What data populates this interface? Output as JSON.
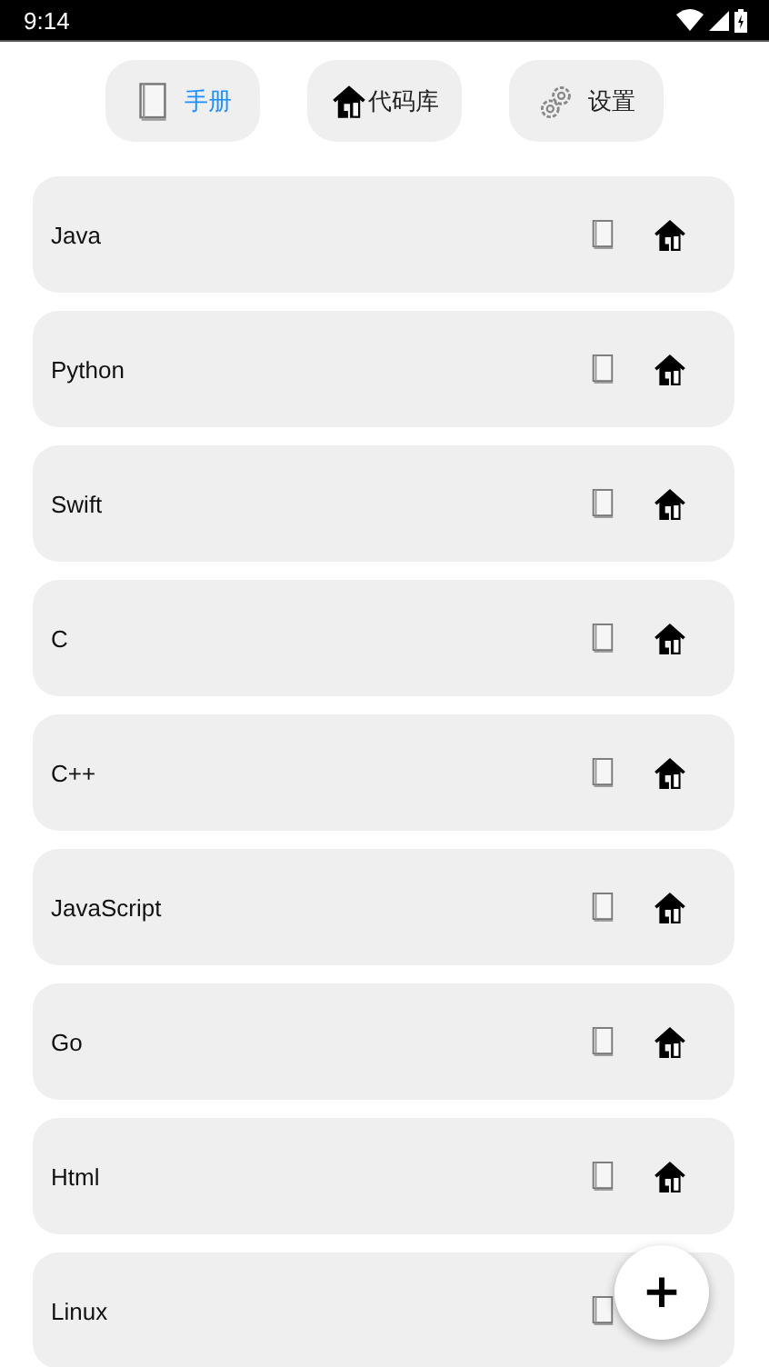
{
  "status_bar": {
    "time": "9:14"
  },
  "tabs": [
    {
      "label": "手册",
      "kind": "book",
      "selected": true
    },
    {
      "label": "代码库",
      "kind": "house",
      "selected": false
    },
    {
      "label": "设置",
      "kind": "gears",
      "selected": false
    }
  ],
  "items": [
    {
      "name": "Java"
    },
    {
      "name": "Python"
    },
    {
      "name": "Swift"
    },
    {
      "name": "C"
    },
    {
      "name": "C++"
    },
    {
      "name": "JavaScript"
    },
    {
      "name": "Go"
    },
    {
      "name": "Html"
    },
    {
      "name": "Linux"
    }
  ],
  "fab": {
    "label": "+"
  }
}
